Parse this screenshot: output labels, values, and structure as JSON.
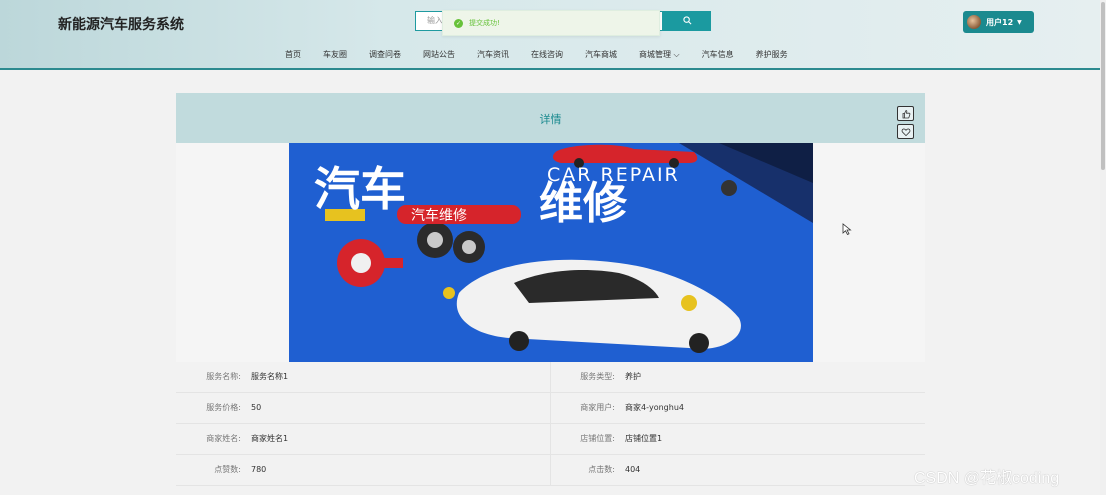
{
  "header": {
    "brand": "新能源汽车服务系统",
    "search_placeholder": "输入",
    "search_button_icon": "search-icon",
    "toast": {
      "message": "提交成功!",
      "icon": "check-circle-icon"
    },
    "user_label": "用户12"
  },
  "nav": {
    "items": [
      "首页",
      "车友圈",
      "调查问卷",
      "网站公告",
      "汽车资讯",
      "在线咨询",
      "汽车商城",
      "商城管理 ⌵",
      "汽车信息",
      "养护服务"
    ]
  },
  "card": {
    "title": "详情",
    "like_icon": "thumbs-up-icon",
    "favorite_icon": "heart-icon",
    "poster": {
      "title_cn": "汽车维修",
      "title_en": "CAR REPAIR",
      "tag": "汽车维修"
    }
  },
  "details": [
    {
      "left_label": "服务名称:",
      "left_value": "服务名称1",
      "right_label": "服务类型:",
      "right_value": "养护"
    },
    {
      "left_label": "服务价格:",
      "left_value": "50",
      "right_label": "商家用户:",
      "right_value": "商家4-yonghu4"
    },
    {
      "left_label": "商家姓名:",
      "left_value": "商家姓名1",
      "right_label": "店铺位置:",
      "right_value": "店铺位置1"
    },
    {
      "left_label": "点赞数:",
      "left_value": "780",
      "right_label": "点击数:",
      "right_value": "404"
    }
  ],
  "watermark": "CSDN @花椒coding",
  "colors": {
    "accent": "#1b9aa0",
    "header_bg": "#c1dbdd",
    "poster_blue": "#1f5fd1"
  }
}
